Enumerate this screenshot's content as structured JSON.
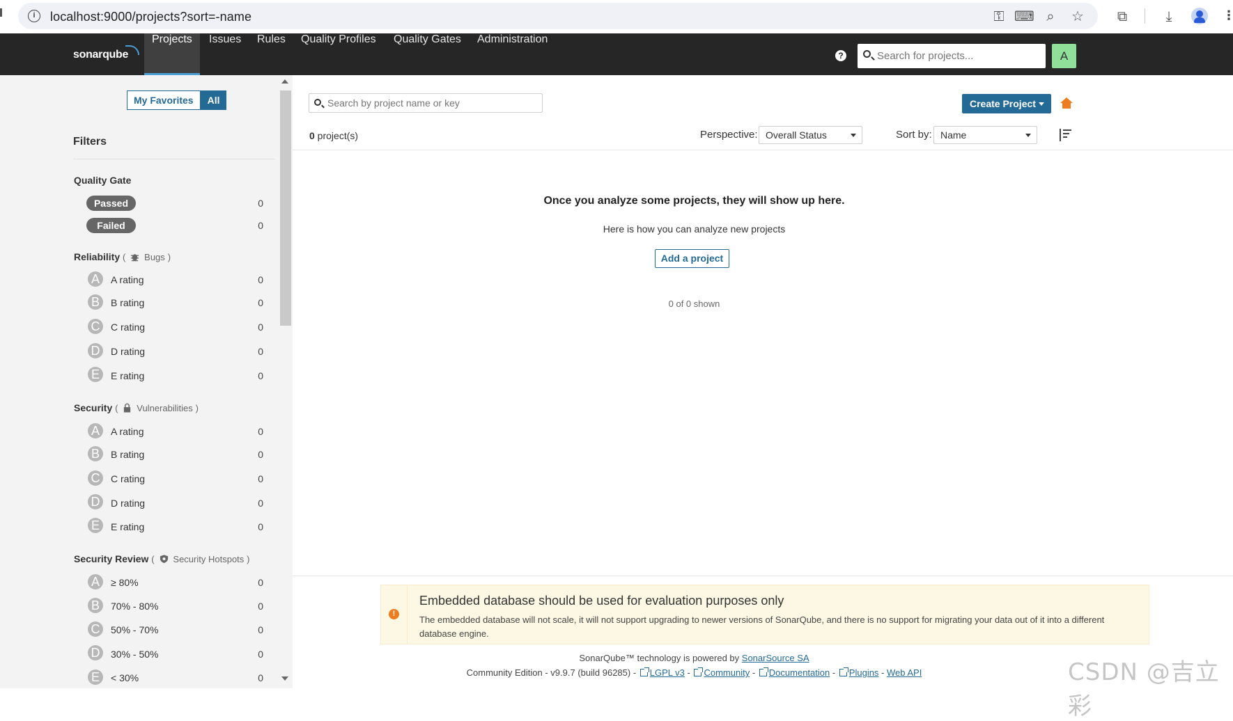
{
  "browser": {
    "url": "localhost:9000/projects?sort=-name"
  },
  "nav": {
    "logo": "sonarqube",
    "items": [
      "Projects",
      "Issues",
      "Rules",
      "Quality Profiles",
      "Quality Gates",
      "Administration"
    ],
    "active": "Projects",
    "search_placeholder": "Search for projects...",
    "avatar_letter": "A"
  },
  "sidebar": {
    "favorites_label": "My Favorites",
    "all_label": "All",
    "filters_title": "Filters",
    "quality_gate": {
      "title": "Quality Gate",
      "items": [
        {
          "label": "Passed",
          "count": "0"
        },
        {
          "label": "Failed",
          "count": "0"
        }
      ]
    },
    "reliability": {
      "title": "Reliability",
      "open": "(",
      "sub": "Bugs",
      "close": ")",
      "items": [
        {
          "grade": "A",
          "label": "A rating",
          "count": "0"
        },
        {
          "grade": "B",
          "label": "B rating",
          "count": "0"
        },
        {
          "grade": "C",
          "label": "C rating",
          "count": "0"
        },
        {
          "grade": "D",
          "label": "D rating",
          "count": "0"
        },
        {
          "grade": "E",
          "label": "E rating",
          "count": "0"
        }
      ]
    },
    "security": {
      "title": "Security",
      "open": "(",
      "sub": "Vulnerabilities",
      "close": ")",
      "items": [
        {
          "grade": "A",
          "label": "A rating",
          "count": "0"
        },
        {
          "grade": "B",
          "label": "B rating",
          "count": "0"
        },
        {
          "grade": "C",
          "label": "C rating",
          "count": "0"
        },
        {
          "grade": "D",
          "label": "D rating",
          "count": "0"
        },
        {
          "grade": "E",
          "label": "E rating",
          "count": "0"
        }
      ]
    },
    "security_review": {
      "title": "Security Review",
      "open": "(",
      "sub": "Security Hotspots",
      "close": ")",
      "items": [
        {
          "grade": "A",
          "label": "≥ 80%",
          "count": "0"
        },
        {
          "grade": "B",
          "label": "70% - 80%",
          "count": "0"
        },
        {
          "grade": "C",
          "label": "50% - 70%",
          "count": "0"
        },
        {
          "grade": "D",
          "label": "30% - 50%",
          "count": "0"
        },
        {
          "grade": "E",
          "label": "< 30%",
          "count": "0"
        }
      ]
    }
  },
  "main": {
    "search_placeholder": "Search by project name or key",
    "create_button": "Create Project",
    "project_count_num": "0",
    "project_count_suffix": " project(s)",
    "perspective_label": "Perspective:",
    "perspective_value": "Overall Status",
    "sort_label": "Sort by:",
    "sort_value": "Name",
    "empty_title": "Once you analyze some projects, they will show up here.",
    "empty_sub": "Here is how you can analyze new projects",
    "add_project": "Add a project",
    "shown": "0 of 0 shown"
  },
  "warning": {
    "title": "Embedded database should be used for evaluation purposes only",
    "text": "The embedded database will not scale, it will not support upgrading to newer versions of SonarQube, and there is no support for migrating your data out of it into a different database engine."
  },
  "footer": {
    "powered_prefix": "SonarQube™ technology is powered by ",
    "powered_link": "SonarSource SA",
    "edition": "Community Edition - v9.9.7 (build 96285) -",
    "links": [
      "LGPL v3",
      "Community",
      "Documentation",
      "Plugins",
      "Web API"
    ]
  },
  "watermark": "CSDN @吉立彩",
  "colors": {
    "accent": "#236a97",
    "nav_bg": "#262626",
    "home": "#ed7d20",
    "avatar": "#90e09a"
  }
}
